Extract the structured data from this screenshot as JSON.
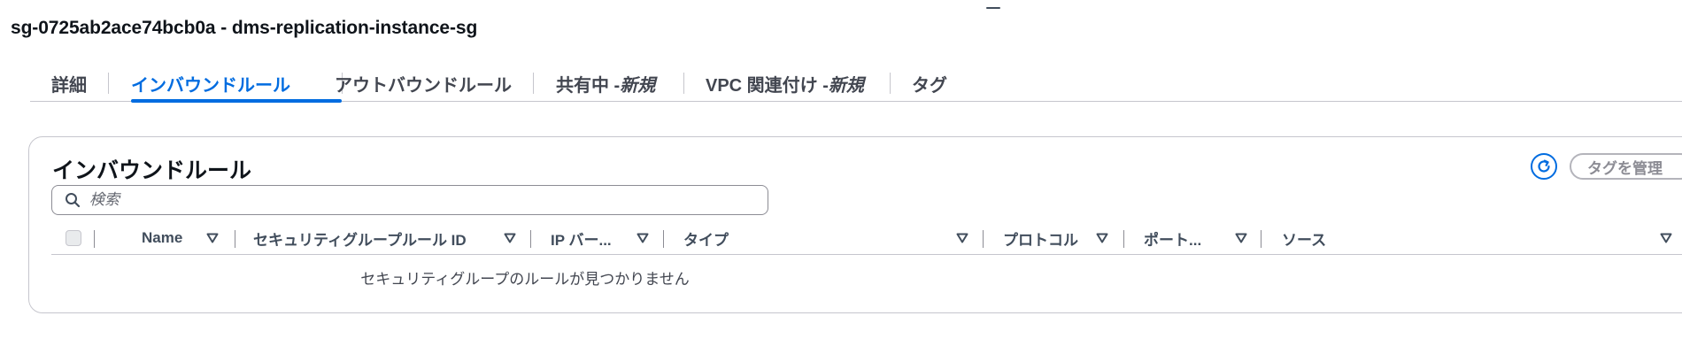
{
  "page": {
    "title": "sg-0725ab2ace74bcb0a - dms-replication-instance-sg"
  },
  "tabs": [
    {
      "label": "詳細",
      "suffix": ""
    },
    {
      "label": "インバウンドルール",
      "suffix": "",
      "active": true
    },
    {
      "label": "アウトバウンドルール",
      "suffix": ""
    },
    {
      "label": "共有中 - ",
      "suffix": "新規"
    },
    {
      "label": "VPC 関連付け - ",
      "suffix": "新規"
    },
    {
      "label": "タグ",
      "suffix": ""
    }
  ],
  "inbound": {
    "title": "インバウンドルール",
    "manage_tags_label": "タグを管理",
    "search_placeholder": "検索",
    "columns": [
      "Name",
      "セキュリティグループルール ID",
      "IP バー...",
      "タイプ",
      "プロトコル",
      "ポート...",
      "ソース"
    ],
    "empty_message": "セキュリティグループのルールが見つかりません"
  },
  "colors": {
    "accent": "#006ce0",
    "text": "#0f141a",
    "border": "#c6c6cd"
  },
  "icons": [
    "refresh-icon",
    "search-icon",
    "sort-caret-down-icon"
  ]
}
